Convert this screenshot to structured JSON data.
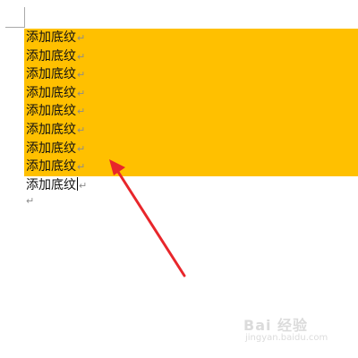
{
  "document": {
    "lines": [
      {
        "text": "添加底纹",
        "mark": "↵"
      },
      {
        "text": "添加底纹",
        "mark": "↵"
      },
      {
        "text": "添加底纹",
        "mark": "↵"
      },
      {
        "text": "添加底纹",
        "mark": "↵"
      },
      {
        "text": "添加底纹",
        "mark": "↵"
      },
      {
        "text": "添加底纹",
        "mark": "↵"
      },
      {
        "text": "添加底纹",
        "mark": "↵"
      },
      {
        "text": "添加底纹",
        "mark": "↵"
      },
      {
        "text": "添加底纹",
        "mark": "↵"
      }
    ],
    "empty_paragraph_mark": "↵",
    "shading_color": "#FFC000",
    "arrow_color": "#E8262B"
  },
  "watermark": {
    "brand": "Bai 经验",
    "url": "jingyan.baidu.com"
  }
}
